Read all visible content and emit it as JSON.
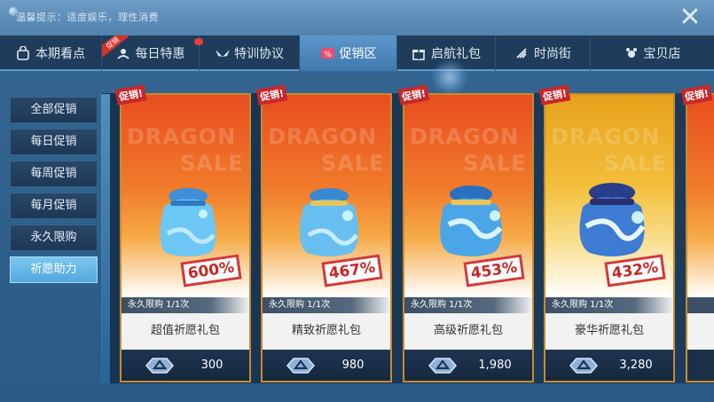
{
  "notice": "温馨提示：适度娱乐，理性消费",
  "tabs": [
    {
      "label": "本期看点",
      "icon": "bag-icon",
      "active": false,
      "dot": false,
      "ribbon": ""
    },
    {
      "label": "每日特惠",
      "icon": "sparkle-icon",
      "active": false,
      "dot": true,
      "ribbon": "促销"
    },
    {
      "label": "特训协议",
      "icon": "wings-icon",
      "active": false,
      "dot": true,
      "ribbon": ""
    },
    {
      "label": "促销区",
      "icon": "sale-tag-icon",
      "active": true,
      "dot": false,
      "ribbon": ""
    },
    {
      "label": "启航礼包",
      "icon": "gift-icon",
      "active": false,
      "dot": false,
      "ribbon": ""
    },
    {
      "label": "时尚街",
      "icon": "hanger-icon",
      "active": false,
      "dot": false,
      "ribbon": ""
    },
    {
      "label": "宝贝店",
      "icon": "pet-icon",
      "active": false,
      "dot": false,
      "ribbon": ""
    }
  ],
  "sidebar": [
    {
      "label": "全部促销",
      "active": false
    },
    {
      "label": "每日促销",
      "active": false
    },
    {
      "label": "每周促销",
      "active": false
    },
    {
      "label": "每月促销",
      "active": false
    },
    {
      "label": "永久限购",
      "active": false
    },
    {
      "label": "祈愿助力",
      "active": true
    }
  ],
  "cards": [
    {
      "tag": "促销!",
      "watermark_top": "DRAGON",
      "watermark_bottom": "SALE",
      "discount": "600%",
      "limit": "永久限购 1/1次",
      "name": "超值祈愿礼包",
      "price": "300",
      "theme": "orange"
    },
    {
      "tag": "促销!",
      "watermark_top": "DRAGON",
      "watermark_bottom": "SALE",
      "discount": "467%",
      "limit": "永久限购 1/1次",
      "name": "精致祈愿礼包",
      "price": "980",
      "theme": "orange"
    },
    {
      "tag": "促销!",
      "watermark_top": "DRAGON",
      "watermark_bottom": "SALE",
      "discount": "453%",
      "limit": "永久限购 1/1次",
      "name": "高级祈愿礼包",
      "price": "1,980",
      "theme": "orange"
    },
    {
      "tag": "促销!",
      "watermark_top": "DRAGON",
      "watermark_bottom": "SALE",
      "discount": "432%",
      "limit": "永久限购 1/1次",
      "name": "豪华祈愿礼包",
      "price": "3,280",
      "theme": "gold"
    }
  ],
  "partial_card": {
    "tag": "促销!"
  },
  "colors": {
    "accent": "#5d97cb",
    "sale_red": "#c6282b",
    "card_border": "#c98a2c",
    "orange_top": "#e84d1f",
    "gold_top": "#e6a11a"
  }
}
